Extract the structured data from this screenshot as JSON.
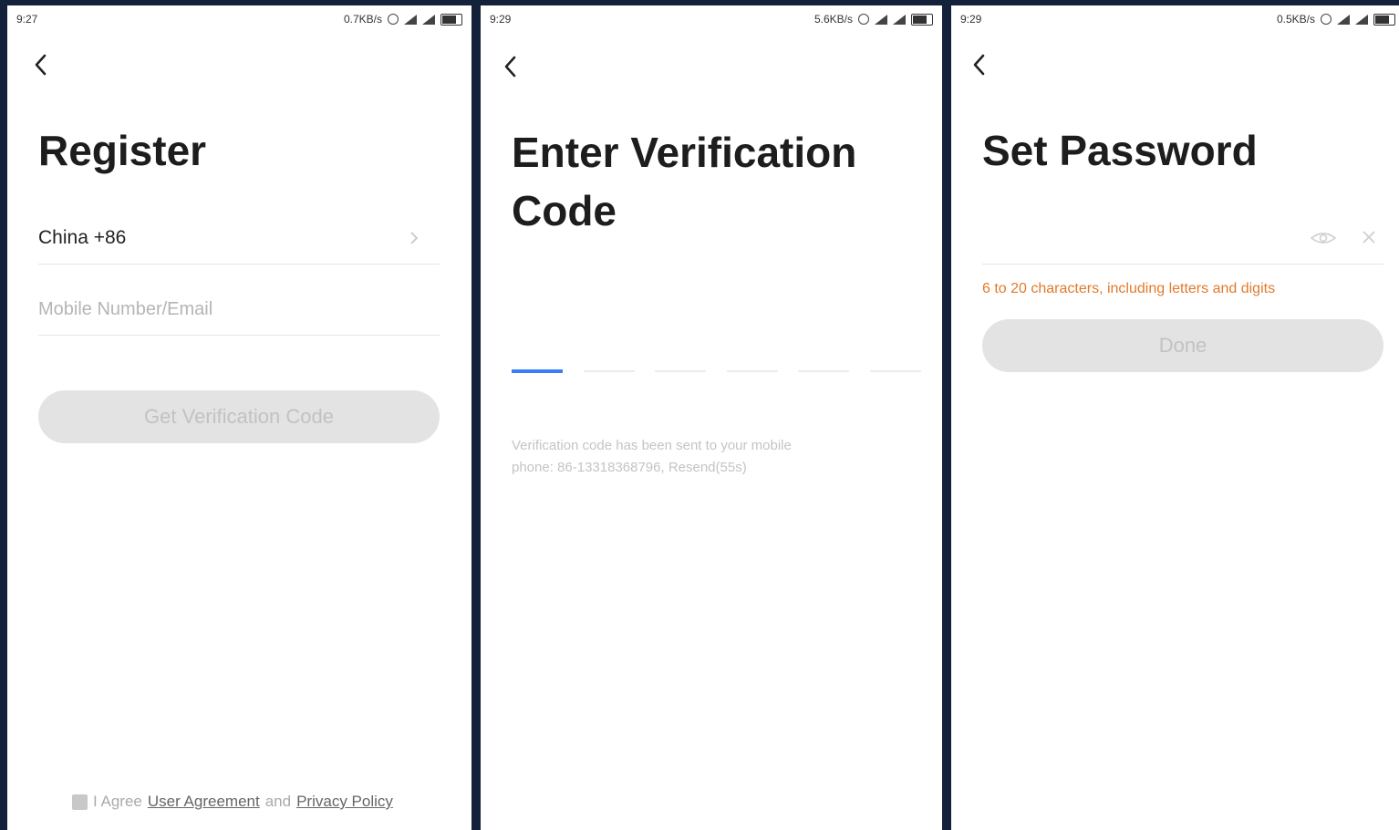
{
  "screens": [
    {
      "status": {
        "time": "9:27",
        "speed": "0.7KB/s"
      },
      "title": "Register",
      "country": "China +86",
      "input_placeholder": "Mobile Number/Email",
      "button": "Get Verification Code",
      "agree": {
        "prefix": "I Agree",
        "link1": "User Agreement",
        "middle": "and",
        "link2": "Privacy Policy"
      }
    },
    {
      "status": {
        "time": "9:29",
        "speed": "5.6KB/s"
      },
      "title_line1": "Enter Verification",
      "title_line2": "Code",
      "hint_line1": "Verification code has been sent to your mobile",
      "hint_line2": "phone: 86-13318368796, Resend(55s)"
    },
    {
      "status": {
        "time": "9:29",
        "speed": "0.5KB/s"
      },
      "title": "Set Password",
      "warning": "6 to 20 characters, including letters and digits",
      "button": "Done"
    }
  ],
  "colors": {
    "accent": "#3a7ff6",
    "warning": "#e07a2c",
    "disabled_button": "#e3e3e3"
  },
  "icons": [
    "back-icon",
    "chevron-right-icon",
    "eye-icon",
    "close-icon",
    "checkbox-icon"
  ]
}
